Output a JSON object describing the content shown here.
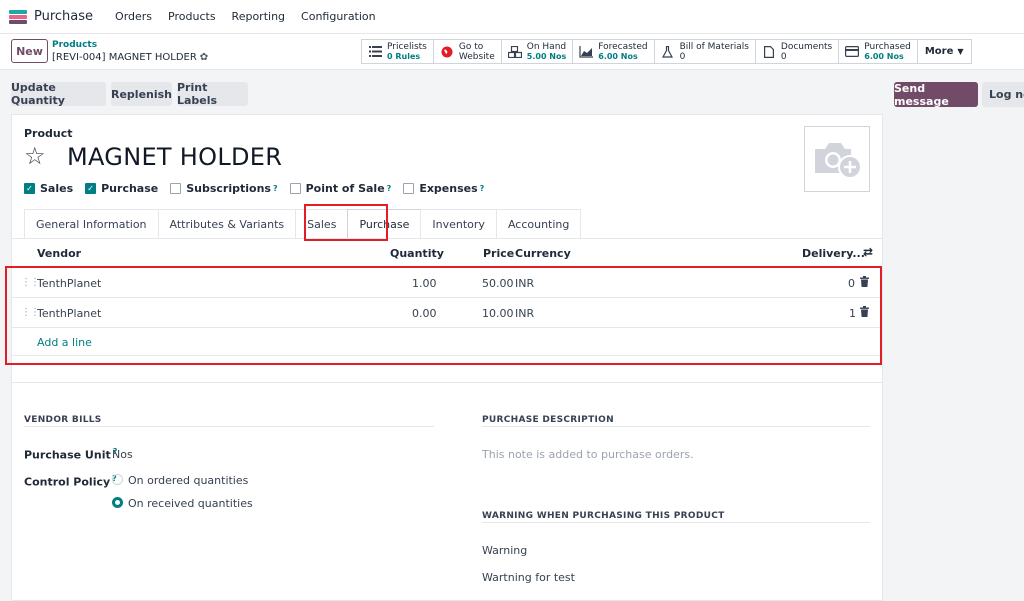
{
  "nav": {
    "app_name": "Purchase",
    "menu": [
      "Orders",
      "Products",
      "Reporting",
      "Configuration"
    ]
  },
  "control": {
    "new_label": "New",
    "breadcrumb_parent": "Products",
    "breadcrumb_current": "[REVI-004] MAGNET HOLDER"
  },
  "smart_buttons": [
    {
      "icon": "list-icon",
      "label": "Pricelists",
      "value": "0 Rules"
    },
    {
      "icon": "globe-icon",
      "label": "Go to",
      "value": "Website"
    },
    {
      "icon": "cubes-icon",
      "label": "On Hand",
      "value": "5.00 Nos"
    },
    {
      "icon": "area-chart-icon",
      "label": "Forecasted",
      "value": "6.00 Nos"
    },
    {
      "icon": "flask-icon",
      "label": "Bill of Materials",
      "value": "0"
    },
    {
      "icon": "file-icon",
      "label": "Documents",
      "value": "0"
    },
    {
      "icon": "credit-card-icon",
      "label": "Purchased",
      "value": "6.00 Nos"
    }
  ],
  "more_label": "More",
  "actions": {
    "update_qty": "Update Quantity",
    "replenish": "Replenish",
    "print_labels": "Print Labels",
    "send_message": "Send message",
    "log_note": "Log not"
  },
  "product": {
    "label": "Product",
    "name": "MAGNET HOLDER",
    "checkboxes": [
      {
        "label": "Sales",
        "checked": true,
        "help": false
      },
      {
        "label": "Purchase",
        "checked": true,
        "help": false
      },
      {
        "label": "Subscriptions",
        "checked": false,
        "help": true
      },
      {
        "label": "Point of Sale",
        "checked": false,
        "help": true
      },
      {
        "label": "Expenses",
        "checked": false,
        "help": true
      }
    ],
    "help_mark": "?"
  },
  "tabs": [
    "General Information",
    "Attributes & Variants",
    "Sales",
    "Purchase",
    "Inventory",
    "Accounting"
  ],
  "active_tab": "Purchase",
  "vendor_table": {
    "headers": {
      "vendor": "Vendor",
      "quantity": "Quantity",
      "price": "Price",
      "currency": "Currency",
      "delivery": "Delivery..."
    },
    "rows": [
      {
        "vendor": "TenthPlanet",
        "quantity": "1.00",
        "price": "50.00",
        "currency": "INR",
        "delivery": "0"
      },
      {
        "vendor": "TenthPlanet",
        "quantity": "0.00",
        "price": "10.00",
        "currency": "INR",
        "delivery": "1"
      }
    ],
    "add_line": "Add a line"
  },
  "vendor_bills": {
    "title": "VENDOR BILLS",
    "purchase_unit_label": "Purchase Unit",
    "purchase_unit_value": "Nos",
    "control_policy_label": "Control Policy",
    "options": [
      {
        "label": "On ordered quantities",
        "selected": false
      },
      {
        "label": "On received quantities",
        "selected": true
      }
    ]
  },
  "purchase_description": {
    "title": "PURCHASE DESCRIPTION",
    "placeholder": "This note is added to purchase orders."
  },
  "warning": {
    "title": "WARNING WHEN PURCHASING THIS PRODUCT",
    "field_value": "Warning",
    "message": "Wartning for test"
  },
  "colors": {
    "brand": "#714b67",
    "accent": "#017e84",
    "highlight": "#e11d27"
  }
}
